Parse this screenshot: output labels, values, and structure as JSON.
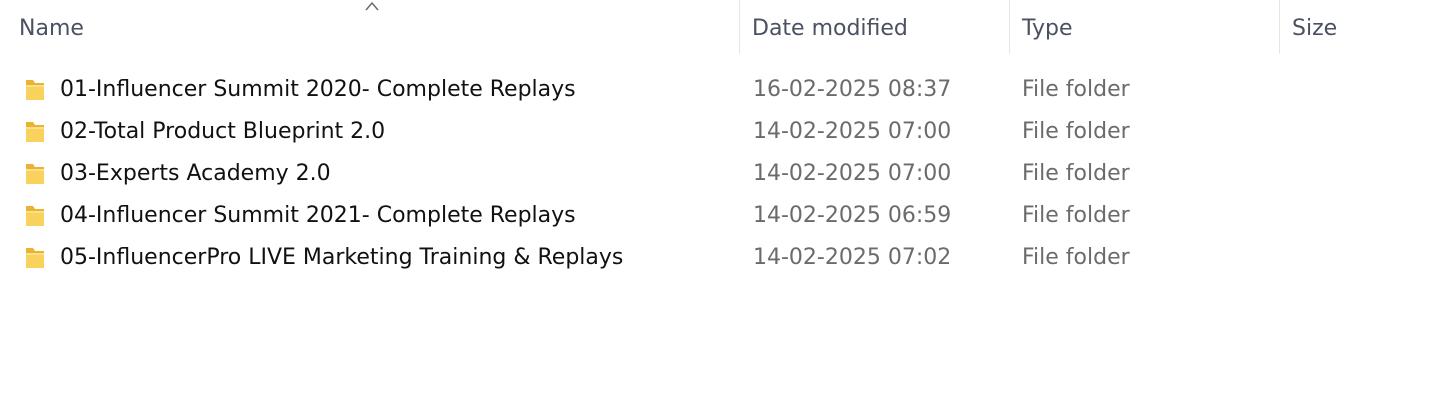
{
  "columns": {
    "name": "Name",
    "date": "Date modified",
    "type": "Type",
    "size": "Size"
  },
  "sort": {
    "column": "name",
    "direction": "ascending"
  },
  "folder_icon_color": "#F5C842",
  "rows": [
    {
      "name": "01-Influencer Summit 2020- Complete Replays",
      "date": "16-02-2025 08:37",
      "type": "File folder",
      "size": ""
    },
    {
      "name": "02-Total Product Blueprint 2.0",
      "date": "14-02-2025 07:00",
      "type": "File folder",
      "size": ""
    },
    {
      "name": "03-Experts Academy 2.0",
      "date": "14-02-2025 07:00",
      "type": "File folder",
      "size": ""
    },
    {
      "name": "04-Influencer Summit 2021- Complete Replays",
      "date": "14-02-2025 06:59",
      "type": "File folder",
      "size": ""
    },
    {
      "name": "05-InfluencerPro LIVE Marketing Training & Replays",
      "date": "14-02-2025 07:02",
      "type": "File folder",
      "size": ""
    }
  ]
}
